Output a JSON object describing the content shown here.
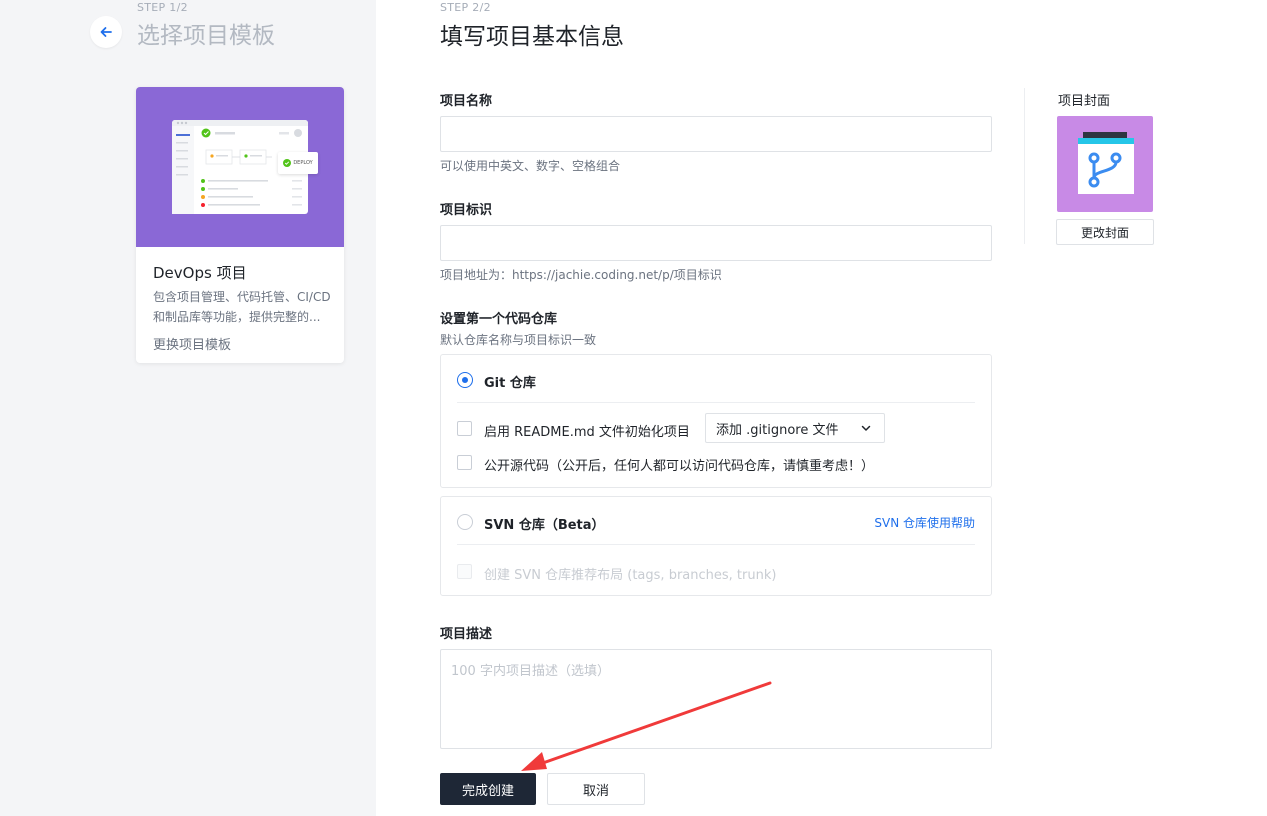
{
  "left": {
    "step": "STEP 1/2",
    "title": "选择项目模板",
    "template": {
      "name": "DevOps 项目",
      "description": "包含项目管理、代码托管、CI/CD 和制品库等功能，提供完整的...",
      "change_label": "更换项目模板",
      "preview_chip": "DEPLOY"
    }
  },
  "main": {
    "step": "STEP 2/2",
    "title": "填写项目基本信息",
    "project_name": {
      "label": "项目名称",
      "value": "",
      "hint": "可以使用中英文、数字、空格组合"
    },
    "project_id": {
      "label": "项目标识",
      "value": "",
      "hint": "项目地址为：https://jachie.coding.net/p/项目标识"
    },
    "repo": {
      "label": "设置第一个代码仓库",
      "hint": "默认仓库名称与项目标识一致",
      "git": {
        "title": "Git 仓库",
        "selected": true,
        "readme_label": "启用 README.md 文件初始化项目",
        "gitignore_select": "添加 .gitignore 文件",
        "public_label": "公开源代码（公开后，任何人都可以访问代码仓库，请慎重考虑！）"
      },
      "svn": {
        "title": "SVN 仓库（Beta）",
        "selected": false,
        "help_link": "SVN 仓库使用帮助",
        "layout_label": "创建 SVN 仓库推荐布局 (tags, branches, trunk)"
      }
    },
    "description": {
      "label": "项目描述",
      "placeholder": "100 字内项目描述（选填）"
    },
    "buttons": {
      "submit": "完成创建",
      "cancel": "取消"
    }
  },
  "cover": {
    "label": "项目封面",
    "change_button": "更改封面",
    "colors": {
      "background": "#c88ae6",
      "icon": "#3b8cf0"
    }
  },
  "colors": {
    "primary": "#1e2736",
    "accent": "#1f6feb",
    "template_thumb": "#8a68d6",
    "annotation_arrow": "#f03a3a"
  }
}
